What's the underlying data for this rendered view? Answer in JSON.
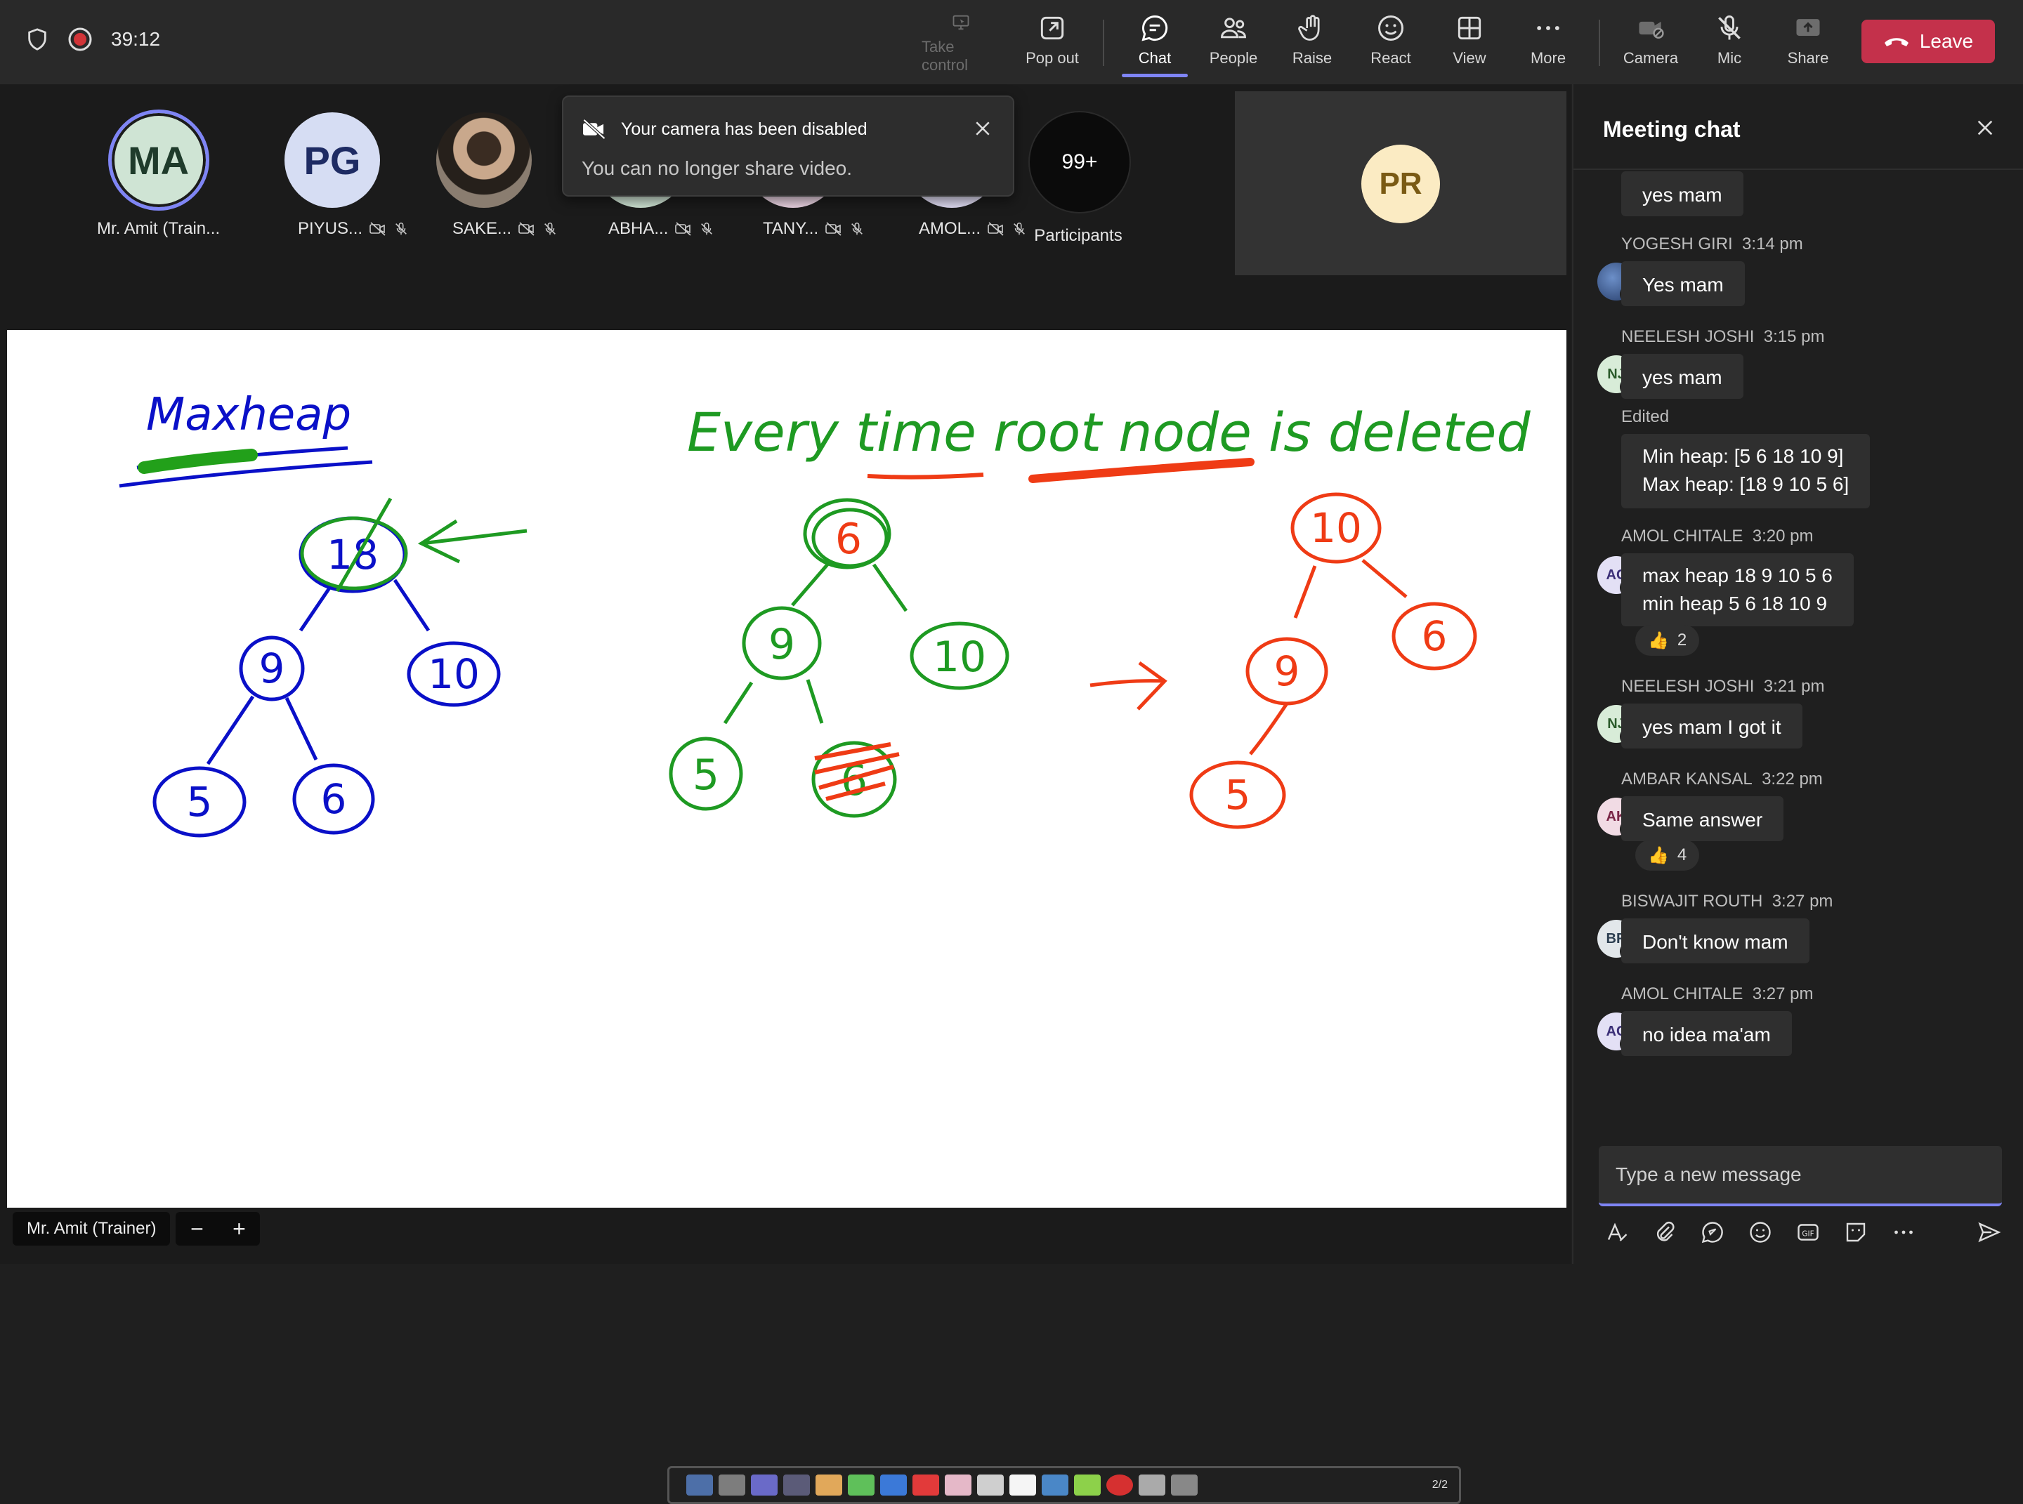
{
  "topbar": {
    "timer": "39:12",
    "buttons": [
      {
        "label": "Take control",
        "icon": "take-control-icon"
      },
      {
        "label": "Pop out",
        "icon": "pop-out-icon"
      },
      {
        "label": "Chat",
        "icon": "chat-icon"
      },
      {
        "label": "People",
        "icon": "people-icon"
      },
      {
        "label": "Raise",
        "icon": "raise-hand-icon"
      },
      {
        "label": "React",
        "icon": "react-icon"
      },
      {
        "label": "View",
        "icon": "view-icon"
      },
      {
        "label": "More",
        "icon": "more-icon"
      },
      {
        "label": "Camera",
        "icon": "camera-off-icon"
      },
      {
        "label": "Mic",
        "icon": "mic-off-icon"
      },
      {
        "label": "Share",
        "icon": "share-icon"
      }
    ],
    "leave_label": "Leave",
    "colors": {
      "leave": "#c4314b",
      "accent": "#7f85f5"
    }
  },
  "participants": [
    {
      "initials": "MA",
      "name": "Mr. Amit (Train...",
      "bg": "#cfe4d4",
      "fg": "#1f3b2b"
    },
    {
      "initials": "PG",
      "name": "PIYUS...",
      "bg": "#d6ddf3",
      "fg": "#1e2b63"
    },
    {
      "initials": "",
      "name": "SAKE...",
      "bg": "#6b5a4b",
      "fg": "#fff"
    },
    {
      "initials": "",
      "name": "ABHA...",
      "bg": "#cfe4d4",
      "fg": "#1f3b2b"
    },
    {
      "initials": "",
      "name": "TANY...",
      "bg": "#ead3e2",
      "fg": "#5a2247"
    },
    {
      "initials": "",
      "name": "AMOL...",
      "bg": "#e0dcf3",
      "fg": "#3b2f77"
    }
  ],
  "participants_more": {
    "count": "99+",
    "label": "Participants"
  },
  "featured_tile": {
    "initials": "PR"
  },
  "toast": {
    "title": "Your camera has been disabled",
    "body": "You can no longer share video."
  },
  "whiteboard": {
    "left_title": "Maxheap",
    "right_title": "Every time root node is deleted",
    "page_indicator": "2/2",
    "trees": {
      "tree1": {
        "color": "#0a10c8",
        "nodes": [
          "18",
          "9",
          "10",
          "5",
          "6"
        ]
      },
      "tree2": {
        "color": "#1e9a22",
        "nodes": [
          "6",
          "9",
          "10",
          "5",
          "6"
        ]
      },
      "tree3": {
        "color": "#ef3b15",
        "nodes": [
          "10",
          "9",
          "6",
          "5"
        ]
      }
    }
  },
  "bottom_bar": {
    "presenter": "Mr. Amit (Trainer)",
    "zoom_out": "−",
    "zoom_in": "+"
  },
  "chat": {
    "title": "Meeting chat",
    "messages": [
      {
        "author": "",
        "time": "",
        "text": "yes mam"
      },
      {
        "author": "YOGESH GIRI",
        "time": "3:14 pm",
        "text": "Yes mam",
        "avatar": "",
        "avatar_bg": "#3b5b8f"
      },
      {
        "author": "NEELESH JOSHI",
        "time": "3:15 pm",
        "text": "yes mam",
        "avatar": "NJ",
        "avatar_bg": "#d8ecd8"
      },
      {
        "author": "",
        "time": "",
        "edited": "Edited",
        "lines": [
          "Min heap: [5 6 18 10 9]",
          "Max heap: [18 9 10 5 6]"
        ]
      },
      {
        "author": "AMOL CHITALE",
        "time": "3:20 pm",
        "avatar": "AC",
        "avatar_bg": "#e3e0f5",
        "lines": [
          "max heap 18 9 10 5 6",
          "min heap 5 6 18 10 9"
        ],
        "reaction": {
          "emoji": "👍",
          "count": "2"
        }
      },
      {
        "author": "NEELESH JOSHI",
        "time": "3:21 pm",
        "text": "yes mam I got it",
        "avatar": "NJ",
        "avatar_bg": "#d8ecd8"
      },
      {
        "author": "AMBAR KANSAL",
        "time": "3:22 pm",
        "text": "Same answer",
        "avatar": "AK",
        "avatar_bg": "#f1dbe4",
        "reaction": {
          "emoji": "👍",
          "count": "4"
        }
      },
      {
        "author": "BISWAJIT ROUTH",
        "time": "3:27 pm",
        "text": "Don't know mam",
        "avatar": "BR",
        "avatar_bg": "#e2e7ea"
      },
      {
        "author": "AMOL CHITALE",
        "time": "3:27 pm",
        "text": "no idea ma'am",
        "avatar": "AC",
        "avatar_bg": "#e3e0f5"
      }
    ],
    "compose_placeholder": "Type a new message"
  }
}
